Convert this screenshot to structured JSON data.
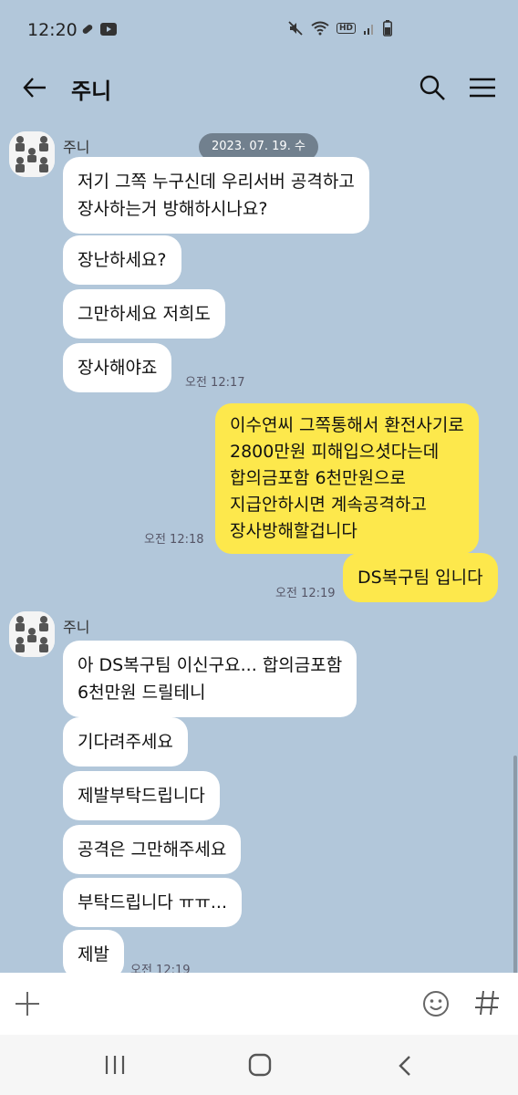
{
  "status_bar": {
    "time": "12:20",
    "hd": "HD"
  },
  "header": {
    "title": "주니",
    "icons": [
      "back-arrow-icon",
      "search-icon",
      "menu-icon"
    ]
  },
  "chat": {
    "date": "2023. 07. 19. 수",
    "group1": {
      "sender": "주니",
      "messages": [
        "저기 그쪽 누구신데 우리서버 공격하고",
        "장사하는거 방해하시나요?",
        "장난하세요?",
        "그만하세요 저희도",
        "장사해야죠"
      ],
      "time": "오전 12:17"
    },
    "outgoing1": {
      "lines": [
        "이수연씨 그쪽통해서 환전사기로",
        "2800만원 피해입으셧다는데",
        "합의금포함  6천만원으로",
        "지급안하시면 계속공격하고",
        "장사방해할겁니다"
      ],
      "time": "오전 12:18"
    },
    "outgoing2": {
      "text": "DS복구팀 입니다",
      "time": "오전 12:19"
    },
    "group2": {
      "sender": "주니",
      "messages": [
        "아 DS복구팀 이신구요... 합의금포함",
        "6천만원 드릴테니",
        "기다려주세요",
        "제발부탁드립니다",
        "공격은 그만해주세요",
        "부탁드립니다 ㅠㅠ...",
        "제발"
      ],
      "time": "오전 12:19"
    }
  },
  "input_bar": {
    "placeholder": "",
    "icons": [
      "plus-icon",
      "emoji-icon",
      "hash-icon"
    ]
  },
  "nav_bar": {
    "icons": [
      "recent-apps-icon",
      "home-icon",
      "back-icon"
    ]
  },
  "colors": {
    "background": "#b2c7da",
    "outgoing_bubble": "#fde84c",
    "incoming_bubble": "#ffffff"
  }
}
